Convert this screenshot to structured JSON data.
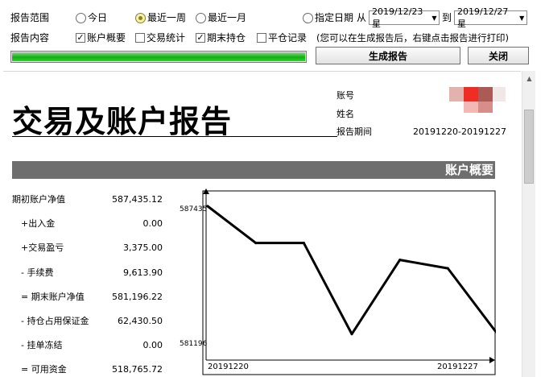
{
  "controls": {
    "range_label": "报告范围",
    "content_label": "报告内容",
    "radios": [
      {
        "label": "今日",
        "selected": false
      },
      {
        "label": "最近一周",
        "selected": true
      },
      {
        "label": "最近一月",
        "selected": false
      },
      {
        "label": "指定日期",
        "selected": false
      }
    ],
    "from_label": "从",
    "to_label": "到",
    "from_date": "2019/12/23 星",
    "to_date": "2019/12/27 星",
    "checkboxes": [
      {
        "label": "账户概要",
        "checked": true
      },
      {
        "label": "交易统计",
        "checked": false
      },
      {
        "label": "期末持仓",
        "checked": true
      },
      {
        "label": "平仓记录",
        "checked": false
      }
    ],
    "hint": "(您可以在生成报告后，右键点击报告进行打印)",
    "progress": 1.0,
    "generate_button": "生成报告",
    "close_button": "关闭"
  },
  "report": {
    "title": "交易及账户报告",
    "info": [
      {
        "label": "账号",
        "value": ""
      },
      {
        "label": "姓名",
        "value": ""
      },
      {
        "label": "报告期间",
        "value": "20191220-20191227"
      }
    ],
    "section_title": "账户概要",
    "rows": [
      {
        "label": "期初账户净值",
        "value": "587,435.12"
      },
      {
        "label": "+出入金",
        "value": "0.00"
      },
      {
        "label": "+交易盈亏",
        "value": "3,375.00"
      },
      {
        "label": "- 手续费",
        "value": "9,613.90"
      },
      {
        "label": "= 期末账户净值",
        "value": "581,196.22"
      },
      {
        "label": "- 持仓占用保证金",
        "value": "62,430.50"
      },
      {
        "label": "- 挂单冻结",
        "value": "0.00"
      },
      {
        "label": "= 可用资金",
        "value": "518,765.72"
      }
    ]
  },
  "chart_data": {
    "type": "line",
    "x_start_label": "20191220",
    "x_end_label": "20191227",
    "y_max_label": "587435",
    "y_min_label": "581196",
    "ylim": [
      581196,
      587435
    ],
    "values": [
      587435,
      585700,
      585700,
      581400,
      584900,
      584500,
      581500
    ]
  }
}
